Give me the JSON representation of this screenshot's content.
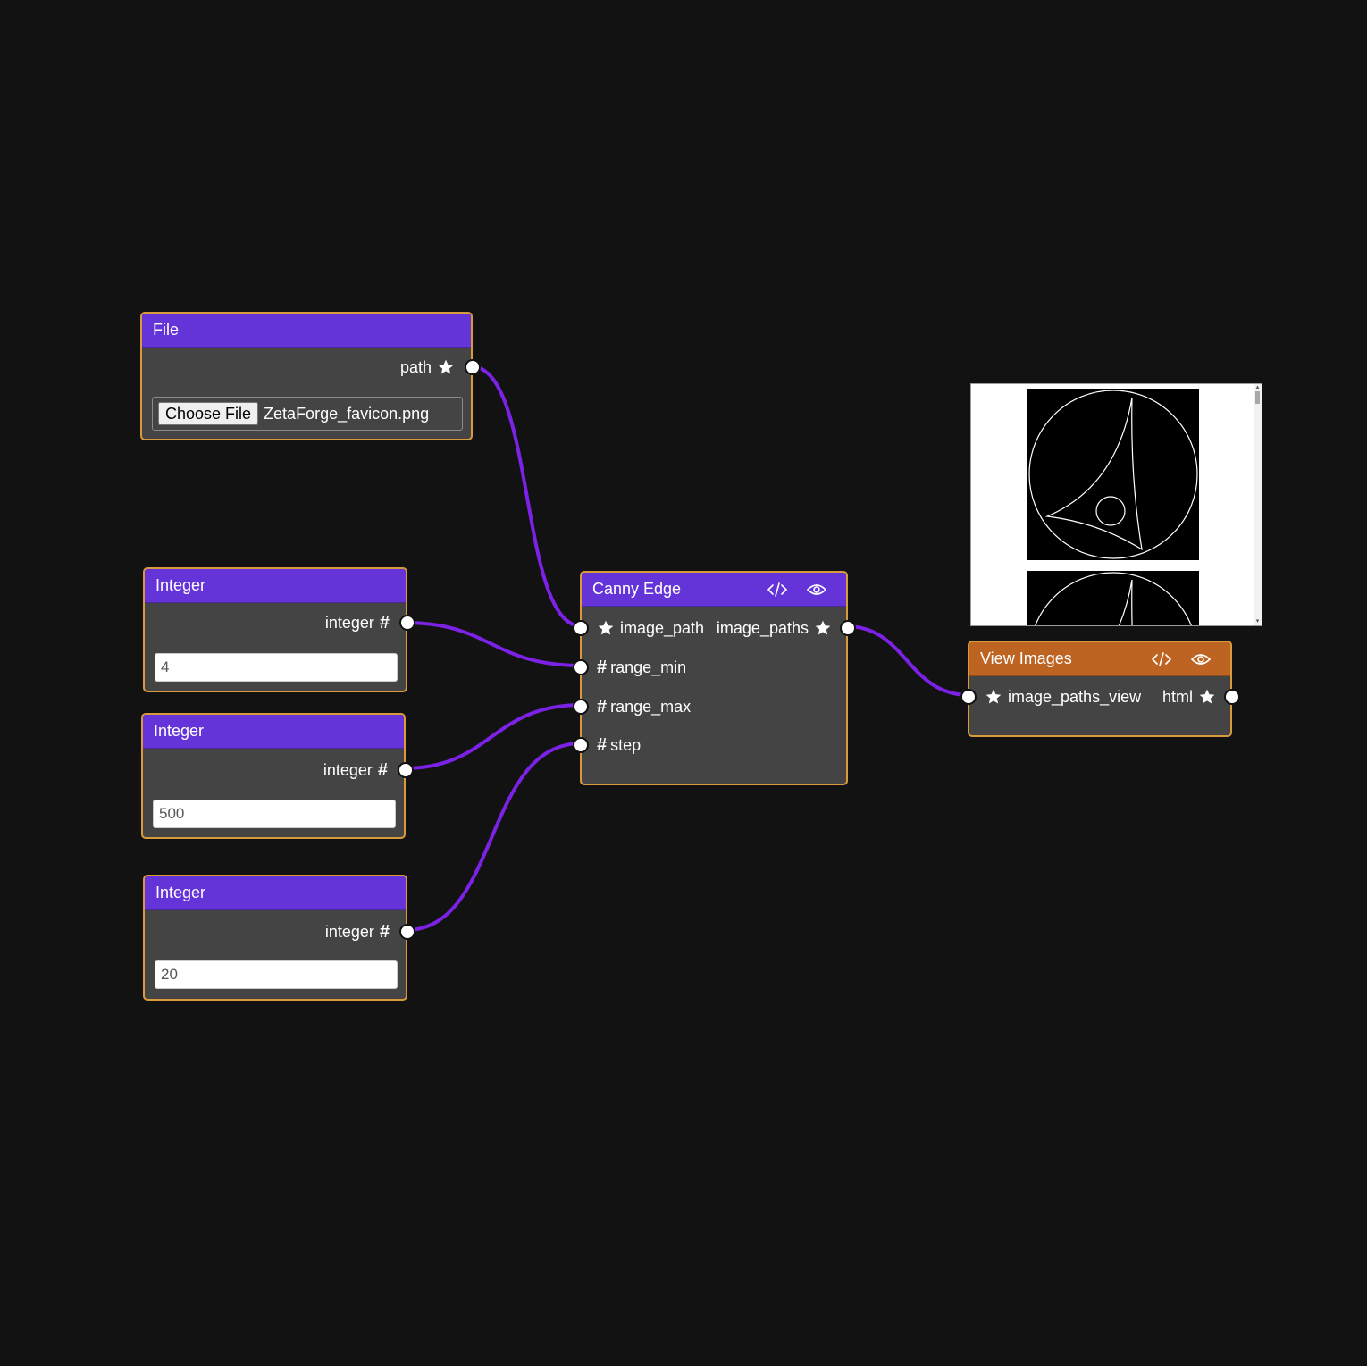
{
  "colors": {
    "canvas_bg": "#121212",
    "node_body": "#444444",
    "node_border": "#d99a3b",
    "header_purple": "#6434d8",
    "header_orange": "#bd6422",
    "wire": "#7b22e6",
    "socket": "#ffffff"
  },
  "icons": {
    "code": "code-icon",
    "eye": "eye-icon",
    "star": "star-icon",
    "hash": "hash-icon"
  },
  "file_node": {
    "title": "File",
    "output_label": "path",
    "choose_button": "Choose File",
    "file_name": "ZetaForge_favicon.png"
  },
  "integer_nodes": [
    {
      "title": "Integer",
      "output_label": "integer",
      "value": "4"
    },
    {
      "title": "Integer",
      "output_label": "integer",
      "value": "500"
    },
    {
      "title": "Integer",
      "output_label": "integer",
      "value": "20"
    }
  ],
  "canny_node": {
    "title": "Canny Edge",
    "inputs": [
      "image_path",
      "range_min",
      "range_max",
      "step"
    ],
    "output_label": "image_paths"
  },
  "view_node": {
    "title": "View Images",
    "input_label": "image_paths_view",
    "output_label": "html"
  },
  "hash_symbol": "#"
}
